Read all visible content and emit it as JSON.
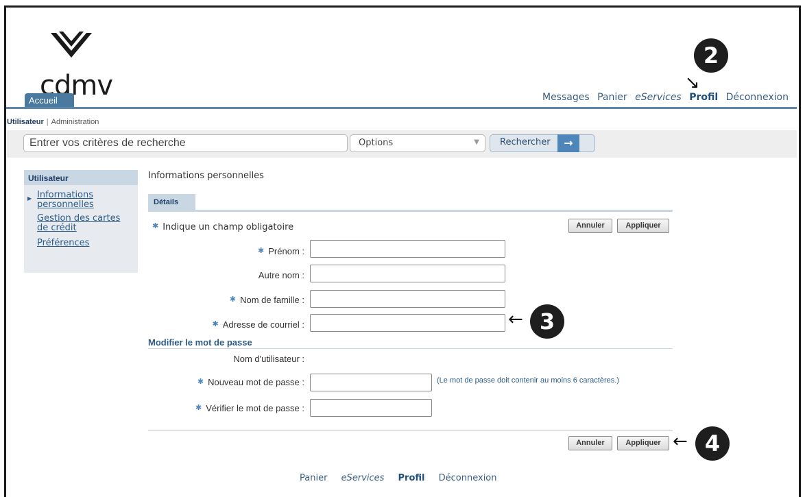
{
  "brand": {
    "logo_text": "cdmv"
  },
  "header": {
    "home_tab": "Accueil",
    "nav": [
      {
        "label": "Messages"
      },
      {
        "label": "Panier"
      },
      {
        "label": "eServices"
      },
      {
        "label": "Profil",
        "active": true
      },
      {
        "label": "Déconnexion"
      }
    ]
  },
  "subnav": {
    "user": "Utilisateur",
    "separator": "|",
    "admin": "Administration"
  },
  "search": {
    "placeholder": "Entrer vos critères de recherche",
    "options_label": "Options",
    "button_label": "Rechercher"
  },
  "sidebar": {
    "title": "Utilisateur",
    "items": [
      {
        "label": "Informations personnelles",
        "selected": true
      },
      {
        "label": "Gestion des cartes de crédit"
      },
      {
        "label": "Préférences"
      }
    ]
  },
  "main": {
    "title": "Informations personnelles",
    "tab": "Détails",
    "required_note": "Indique un champ obligatoire",
    "cancel_label": "Annuler",
    "apply_label": "Appliquer",
    "fields": {
      "first_name": {
        "label": "Prénom :",
        "required": true,
        "value": ""
      },
      "other_name": {
        "label": "Autre nom :",
        "required": false,
        "value": ""
      },
      "last_name": {
        "label": "Nom de famille :",
        "required": true,
        "value": ""
      },
      "email": {
        "label": "Adresse de courriel :",
        "required": true,
        "value": ""
      }
    },
    "password_section": {
      "title": "Modifier le mot de passe",
      "username_label": "Nom d'utilisateur :",
      "new_password_label": "Nouveau mot de passe :",
      "verify_password_label": "Vérifier le mot de passe :",
      "hint": "(Le mot de passe doit contenir au moins 6 caractères.)"
    }
  },
  "footer": {
    "nav": [
      {
        "label": "Panier"
      },
      {
        "label": "eServices"
      },
      {
        "label": "Profil",
        "active": true
      },
      {
        "label": "Déconnexion"
      }
    ]
  },
  "annotations": {
    "step2": "2",
    "step3": "3",
    "step4": "4"
  },
  "colors": {
    "accent": "#4f86b9",
    "tab_bg": "#c9d6e3",
    "link": "#2d5c88"
  }
}
